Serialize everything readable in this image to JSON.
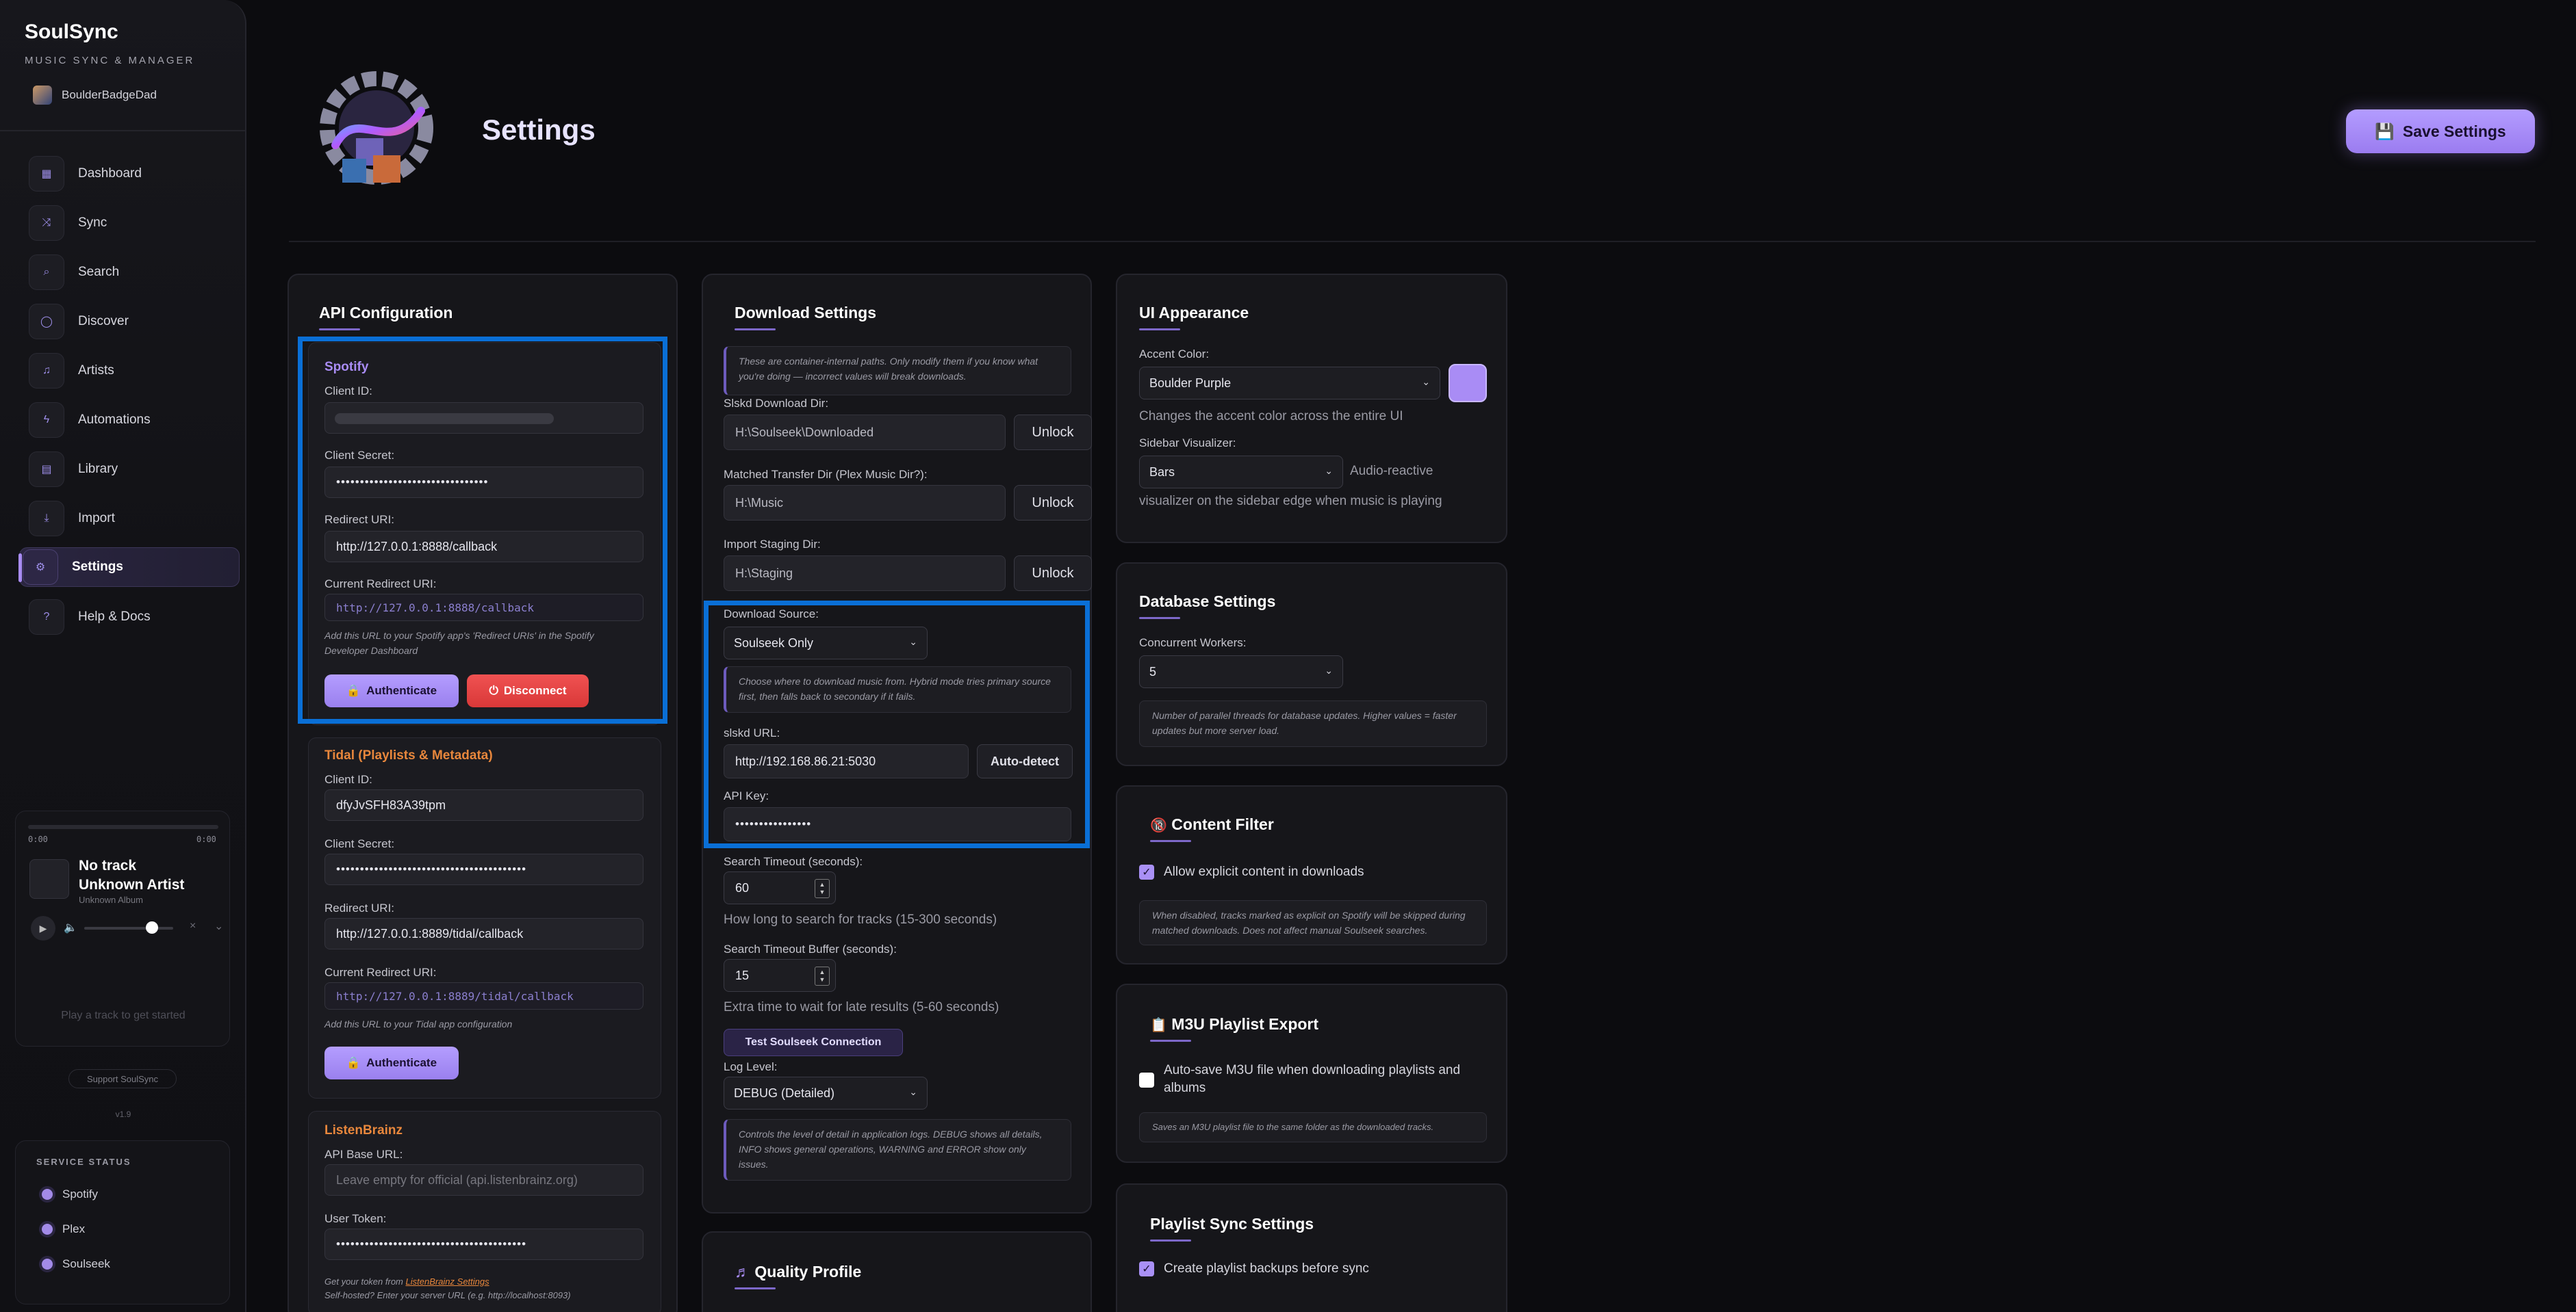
{
  "app": {
    "name": "SoulSync",
    "subtitle": "MUSIC SYNC & MANAGER",
    "user": "BoulderBadgeDad",
    "version": "v1.9",
    "support_label": "Support SoulSync"
  },
  "nav": [
    {
      "label": "Dashboard",
      "icon": "dashboard-icon",
      "glyph": "▦"
    },
    {
      "label": "Sync",
      "icon": "shuffle-icon",
      "glyph": "⤨"
    },
    {
      "label": "Search",
      "icon": "search-icon",
      "glyph": "⌕"
    },
    {
      "label": "Discover",
      "icon": "compass-icon",
      "glyph": "◯"
    },
    {
      "label": "Artists",
      "icon": "music-note-icon",
      "glyph": "♫"
    },
    {
      "label": "Automations",
      "icon": "lightning-icon",
      "glyph": "ϟ"
    },
    {
      "label": "Library",
      "icon": "book-icon",
      "glyph": "▤"
    },
    {
      "label": "Import",
      "icon": "download-icon",
      "glyph": "⤓"
    },
    {
      "label": "Settings",
      "icon": "gear-icon",
      "glyph": "⚙"
    },
    {
      "label": "Help & Docs",
      "icon": "help-icon",
      "glyph": "?"
    }
  ],
  "player": {
    "time_current": "0:00",
    "time_total": "0:00",
    "title": "No track",
    "artist": "Unknown Artist",
    "album": "Unknown Album",
    "hint": "Play a track to get started"
  },
  "service_status": {
    "heading": "SERVICE STATUS",
    "services": [
      "Spotify",
      "Plex",
      "Soulseek"
    ]
  },
  "header": {
    "title": "Settings",
    "save_label": "Save Settings",
    "save_glyph": "💾"
  },
  "api": {
    "title": "API Configuration",
    "spotify": {
      "title": "Spotify",
      "client_id_label": "Client ID:",
      "client_secret_label": "Client Secret:",
      "client_secret_value": "••••••••••••••••••••••••••••••••",
      "redirect_label": "Redirect URI:",
      "redirect_value": "http://127.0.0.1:8888/callback",
      "current_redirect_label": "Current Redirect URI:",
      "current_redirect_value": "http://127.0.0.1:8888/callback",
      "hint": "Add this URL to your Spotify app's 'Redirect URIs' in the Spotify Developer Dashboard",
      "auth_label": "Authenticate",
      "disconnect_label": "Disconnect"
    },
    "tidal": {
      "title": "Tidal (Playlists & Metadata)",
      "client_id_label": "Client ID:",
      "client_id_value": "dfyJvSFH83A39tpm",
      "client_secret_label": "Client Secret:",
      "client_secret_value": "••••••••••••••••••••••••••••••••••••••••",
      "redirect_label": "Redirect URI:",
      "redirect_value": "http://127.0.0.1:8889/tidal/callback",
      "current_redirect_label": "Current Redirect URI:",
      "current_redirect_value": "http://127.0.0.1:8889/tidal/callback",
      "hint": "Add this URL to your Tidal app configuration",
      "auth_label": "Authenticate"
    },
    "listenbrainz": {
      "title": "ListenBrainz",
      "base_label": "API Base URL:",
      "base_placeholder": "Leave empty for official (api.listenbrainz.org)",
      "token_label": "User Token:",
      "token_value": "••••••••••••••••••••••••••••••••••••••••",
      "hint_prefix": "Get your token from ",
      "hint_link": "ListenBrainz Settings",
      "hint2": "Self-hosted? Enter your server URL (e.g. http://localhost:8093)"
    }
  },
  "download": {
    "title": "Download Settings",
    "paths_hint": "These are container-internal paths. Only modify them if you know what you're doing — incorrect values will break downloads.",
    "slskd_dir_label": "Slskd Download Dir:",
    "slskd_dir_value": "H:\\Soulseek\\Downloaded",
    "transfer_dir_label": "Matched Transfer Dir (Plex Music Dir?):",
    "transfer_dir_value": "H:\\Music",
    "staging_dir_label": "Import Staging Dir:",
    "staging_dir_value": "H:\\Staging",
    "unlock_label": "Unlock",
    "source_label": "Download Source:",
    "source_value": "Soulseek Only",
    "source_hint": "Choose where to download music from. Hybrid mode tries primary source first, then falls back to secondary if it fails.",
    "slskd_url_label": "slskd URL:",
    "slskd_url_value": "http://192.168.86.21:5030",
    "autodetect_label": "Auto-detect",
    "api_key_label": "API Key:",
    "api_key_value": "••••••••••••••••",
    "timeout_label": "Search Timeout (seconds):",
    "timeout_value": "60",
    "timeout_note": "How long to search for tracks (15-300 seconds)",
    "buffer_label": "Search Timeout Buffer (seconds):",
    "buffer_value": "15",
    "buffer_note": "Extra time to wait for late results (5-60 seconds)",
    "test_label": "Test Soulseek Connection",
    "log_label": "Log Level:",
    "log_value": "DEBUG (Detailed)",
    "log_hint": "Controls the level of detail in application logs. DEBUG shows all details, INFO shows general operations, WARNING and ERROR show only issues."
  },
  "quality": {
    "title": "Quality Profile",
    "glyph": "♬"
  },
  "ui_appearance": {
    "title": "UI Appearance",
    "accent_label": "Accent Color:",
    "accent_value": "Boulder Purple",
    "accent_color": "#a98cf5",
    "accent_note": "Changes the accent color across the entire UI",
    "visualizer_label": "Sidebar Visualizer:",
    "visualizer_value": "Bars",
    "visualizer_note_1": "Audio-reactive",
    "visualizer_note_2": "visualizer on the sidebar edge when music is playing"
  },
  "database": {
    "title": "Database Settings",
    "workers_label": "Concurrent Workers:",
    "workers_value": "5",
    "hint": "Number of parallel threads for database updates. Higher values = faster updates but more server load."
  },
  "content_filter": {
    "title": "Content Filter",
    "glyph": "🔞",
    "checkbox_label": "Allow explicit content in downloads",
    "hint": "When disabled, tracks marked as explicit on Spotify will be skipped during matched downloads. Does not affect manual Soulseek searches."
  },
  "m3u": {
    "title": "M3U Playlist Export",
    "glyph": "📋",
    "checkbox_label": "Auto-save M3U file when downloading playlists and albums",
    "hint": "Saves an M3U playlist file to the same folder as the downloaded tracks."
  },
  "playlist_sync": {
    "title": "Playlist Sync Settings",
    "checkbox_label": "Create playlist backups before sync"
  }
}
